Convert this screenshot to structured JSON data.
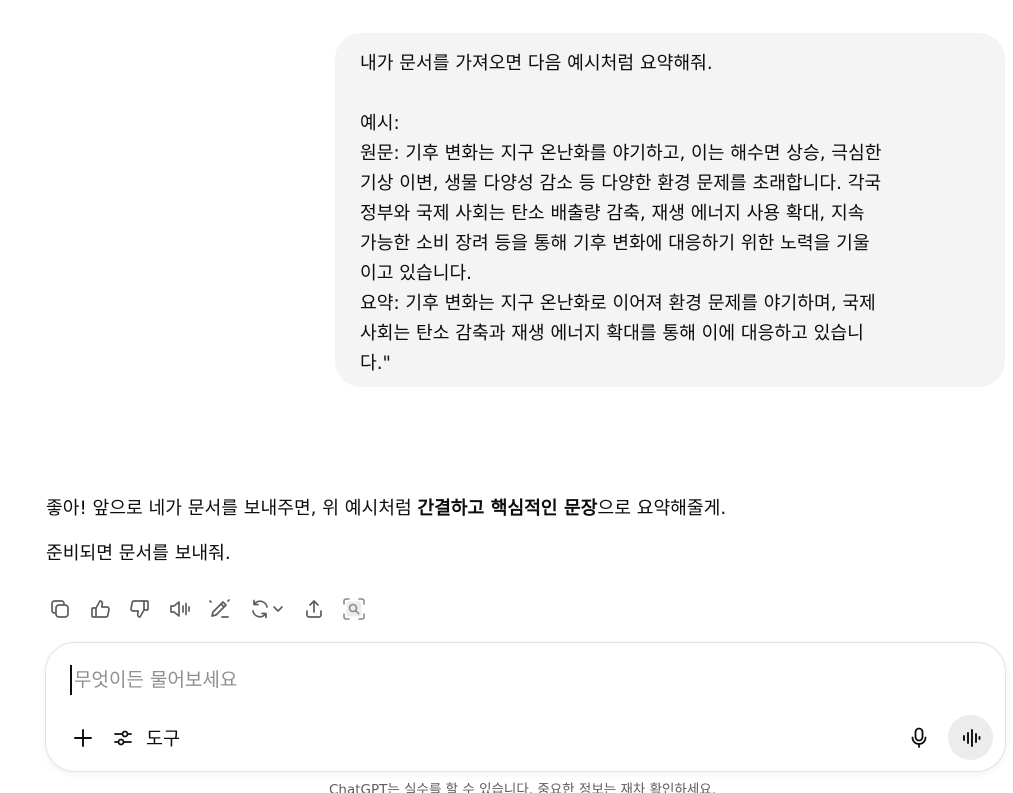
{
  "user_message": {
    "lines": [
      "내가 문서를 가져오면 다음 예시처럼 요약해줘.",
      "",
      "예시:",
      "원문: 기후 변화는 지구 온난화를 야기하고, 이는 해수면 상승, 극심한",
      "기상 이변, 생물 다양성 감소 등 다양한 환경 문제를 초래합니다. 각국",
      "정부와 국제 사회는 탄소 배출량 감축, 재생 에너지 사용 확대, 지속",
      "가능한 소비 장려 등을 통해 기후 변화에 대응하기 위한 노력을 기울",
      "이고 있습니다.",
      "요약: 기후 변화는 지구 온난화로 이어져 환경 문제를 야기하며, 국제",
      "사회는 탄소 감축과 재생 에너지 확대를 통해 이에 대응하고 있습니",
      "다.\""
    ]
  },
  "assistant_message": {
    "p1_before": "좋아! 앞으로 네가 문서를 보내주면, 위 예시처럼 ",
    "p1_bold": "간결하고 핵심적인 문장",
    "p1_after": "으로 요약해줄게.",
    "p2": "준비되면 문서를 보내줘."
  },
  "actions": {
    "icons": [
      "copy-icon",
      "thumbs-up-icon",
      "thumbs-down-icon",
      "read-aloud-icon",
      "edit-icon",
      "regenerate-icon",
      "share-icon",
      "search-icon"
    ]
  },
  "composer": {
    "placeholder": "무엇이든 물어보세요",
    "tools_label": "도구"
  },
  "disclaimer": "ChatGPT는 실수를 할 수 있습니다. 중요한 정보는 재차 확인하세요."
}
